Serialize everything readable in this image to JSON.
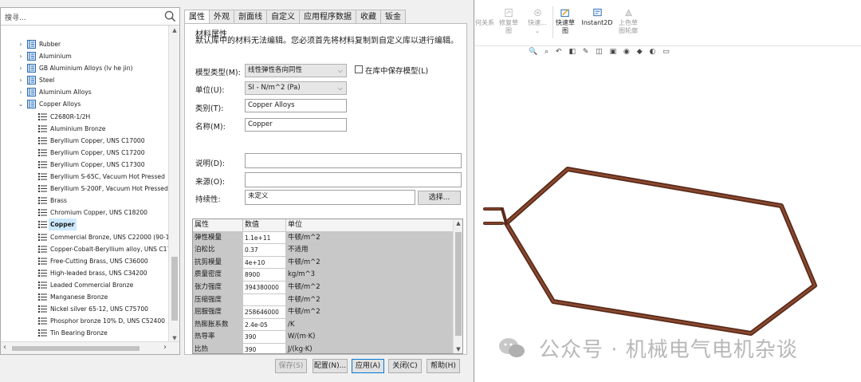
{
  "search": {
    "placeholder": "搜寻..."
  },
  "tree": [
    {
      "label": "Rubber",
      "level": 0
    },
    {
      "label": "Aluminium",
      "level": 0
    },
    {
      "label": "GB Aluminium Alloys (lv he jin)",
      "level": 0
    },
    {
      "label": "Steel",
      "level": 0
    },
    {
      "label": "Aluminium Alloys",
      "level": 0
    },
    {
      "label": "Copper Alloys",
      "level": 0,
      "expanded": true
    },
    {
      "label": "C2680R-1/2H",
      "level": 1
    },
    {
      "label": "Aluminium Bronze",
      "level": 1
    },
    {
      "label": "Beryllium Copper, UNS C17000",
      "level": 1
    },
    {
      "label": "Beryllium Copper, UNS C17200",
      "level": 1
    },
    {
      "label": "Beryllium Copper, UNS C17300",
      "level": 1
    },
    {
      "label": "Beryllium S-65C, Vacuum Hot Pressed",
      "level": 1
    },
    {
      "label": "Beryllium S-200F, Vacuum Hot Pressed",
      "level": 1
    },
    {
      "label": "Brass",
      "level": 1
    },
    {
      "label": "Chromium Copper, UNS C18200",
      "level": 1
    },
    {
      "label": "Copper",
      "level": 1,
      "selected": true
    },
    {
      "label": "Commercial Bronze, UNS C22000 (90-10",
      "level": 1
    },
    {
      "label": "Copper-Cobalt-Beryllium alloy, UNS C17",
      "level": 1
    },
    {
      "label": "Free-Cutting Brass, UNS C36000",
      "level": 1
    },
    {
      "label": "High-leaded brass, UNS C34200",
      "level": 1
    },
    {
      "label": "Leaded Commercial Bronze",
      "level": 1
    },
    {
      "label": "Manganese Bronze",
      "level": 1
    },
    {
      "label": "Nickel silver 65-12, UNS C75700",
      "level": 1
    },
    {
      "label": "Phosphor bronze 10% D, UNS C52400",
      "level": 1
    },
    {
      "label": "Tin Bearing Bronze",
      "level": 1
    }
  ],
  "tabs": [
    "属性",
    "外观",
    "剖面线",
    "自定义",
    "应用程序数据",
    "收藏",
    "钣金"
  ],
  "props": {
    "group_title": "材料属性",
    "group_desc": "默认库中的材料无法编辑。您必须首先将材料复制到自定义库以进行编辑。",
    "model_type_label": "模型类型(M):",
    "model_type_value": "线性弹性各向同性",
    "save_in_lib_label": "在库中保存模型(L)",
    "unit_label": "单位(U):",
    "unit_value": "SI - N/m^2 (Pa)",
    "category_label": "类别(T):",
    "category_value": "Copper Alloys",
    "name_label": "名称(M):",
    "name_value": "Copper",
    "desc_label": "说明(D):",
    "desc_value": "",
    "source_label": "来源(O):",
    "source_value": "",
    "sustain_label": "持续性:",
    "sustain_value": "未定义",
    "choose_button": "选择..."
  },
  "table": {
    "headers": [
      "属性",
      "数值",
      "单位"
    ],
    "rows": [
      [
        "弹性模量",
        "1.1e+11",
        "牛顿/m^2"
      ],
      [
        "泊松比",
        "0.37",
        "不适用"
      ],
      [
        "抗剪模量",
        "4e+10",
        "牛顿/m^2"
      ],
      [
        "质量密度",
        "8900",
        "kg/m^3"
      ],
      [
        "张力强度",
        "394380000",
        "牛顿/m^2"
      ],
      [
        "压缩强度",
        "",
        "牛顿/m^2"
      ],
      [
        "屈服强度",
        "258646000",
        "牛顿/m^2"
      ],
      [
        "热膨胀系数",
        "2.4e-05",
        "/K"
      ],
      [
        "热导率",
        "390",
        "W/(m·K)"
      ],
      [
        "比热",
        "390",
        "J/(kg·K)"
      ]
    ]
  },
  "footer": {
    "save": "保存(S)",
    "config": "配置(N)...",
    "apply": "应用(A)",
    "close": "关闭(C)",
    "help": "帮助(H)"
  },
  "toolbar": {
    "items": [
      {
        "label": "何关系",
        "active": false
      },
      {
        "label": "修复草\n图",
        "active": false
      },
      {
        "label": "快速...",
        "active": false
      },
      {
        "label": "快速草\n图",
        "active": true
      },
      {
        "label": "Instant2D",
        "active": true
      },
      {
        "label": "上色草\n图轮廓",
        "active": false
      }
    ]
  },
  "watermark": "公众号 · 机械电气电机杂谈",
  "colors": {
    "model": "#5a2a1a",
    "selection": "#cce8ff",
    "accent": "#0078d7"
  }
}
